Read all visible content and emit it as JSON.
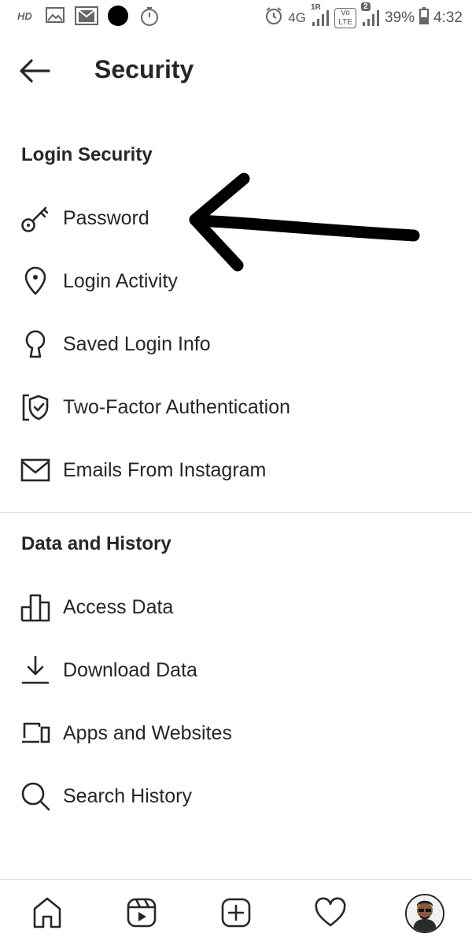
{
  "status_bar": {
    "hd": "HD",
    "network": "4G",
    "sim1": "1R",
    "volte": "Vo LTE",
    "sim2": "2",
    "battery": "39%",
    "time": "4:32"
  },
  "header": {
    "title": "Security"
  },
  "login_security": {
    "title": "Login Security",
    "items": [
      {
        "label": "Password",
        "icon": "key-icon"
      },
      {
        "label": "Login Activity",
        "icon": "location-pin-icon"
      },
      {
        "label": "Saved Login Info",
        "icon": "keyhole-icon"
      },
      {
        "label": "Two-Factor Authentication",
        "icon": "shield-check-icon"
      },
      {
        "label": "Emails From Instagram",
        "icon": "envelope-icon"
      }
    ]
  },
  "data_history": {
    "title": "Data and History",
    "items": [
      {
        "label": "Access Data",
        "icon": "bar-chart-icon"
      },
      {
        "label": "Download Data",
        "icon": "download-icon"
      },
      {
        "label": "Apps and Websites",
        "icon": "devices-icon"
      },
      {
        "label": "Search History",
        "icon": "search-icon"
      }
    ]
  },
  "bottom_nav": {
    "items": [
      "home-icon",
      "reels-icon",
      "new-post-icon",
      "heart-icon",
      "profile-avatar"
    ]
  },
  "colors": {
    "text": "#262626",
    "divider": "#dbdbdb",
    "background": "#ffffff",
    "status_text": "#555555"
  }
}
